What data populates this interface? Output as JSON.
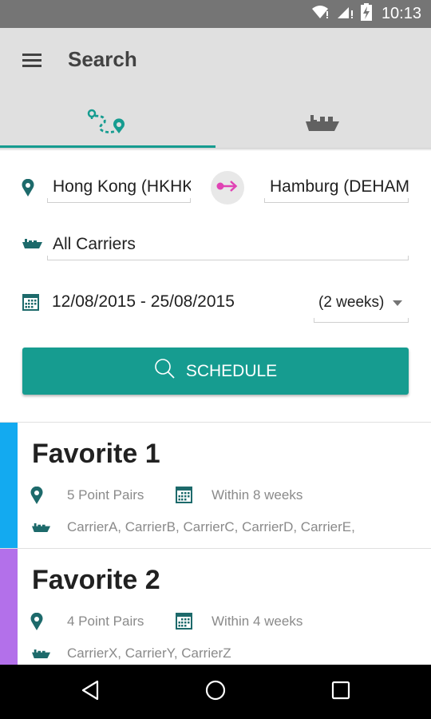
{
  "status_bar": {
    "time": "10:13"
  },
  "app_bar": {
    "title": "Search",
    "tabs": [
      {
        "name": "route",
        "icon": "route-icon",
        "active": true
      },
      {
        "name": "vessel",
        "icon": "ship-icon",
        "active": false
      }
    ]
  },
  "form": {
    "origin_value": "Hong Kong (HKHKG)",
    "destination_value": "Hamburg (DEHAM)",
    "carrier_value": "All Carriers",
    "date_range": "12/08/2015 - 25/08/2015",
    "range_option": "(2 weeks)",
    "schedule_button": "SCHEDULE"
  },
  "favorites": [
    {
      "title": "Favorite 1",
      "color": "#13aaf0",
      "point_pairs": "5 Point Pairs",
      "window": "Within 8 weeks",
      "carriers": "CarrierA, CarrierB, CarrierC, CarrierD, CarrierE,"
    },
    {
      "title": "Favorite 2",
      "color": "#b370ea",
      "point_pairs": "4 Point Pairs",
      "window": "Within 4 weeks",
      "carriers": "CarrierX, CarrierY, CarrierZ"
    }
  ],
  "colors": {
    "accent": "#169c90",
    "icon_dark": "#1d6a6b",
    "swap_arrow": "#e043b4"
  }
}
